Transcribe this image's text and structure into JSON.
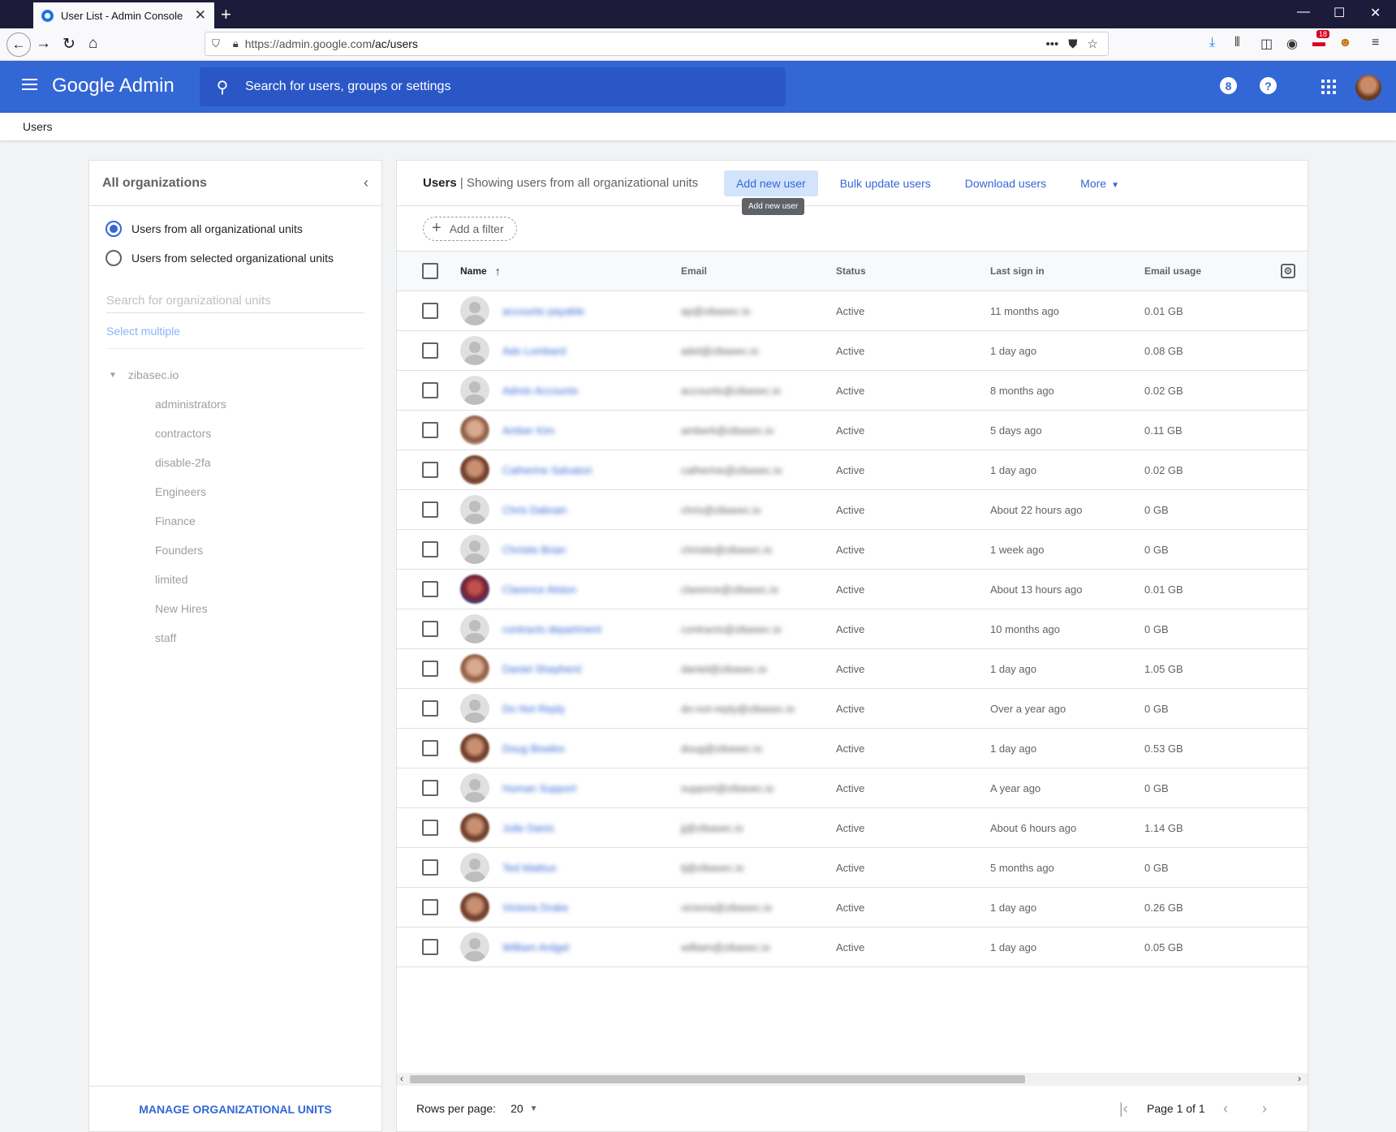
{
  "browser": {
    "tab_title": "User List - Admin Console",
    "url_host": "https://admin.google.com",
    "url_path": "/ac/users",
    "badge_count": "18"
  },
  "header": {
    "brand": "Google Admin",
    "search_placeholder": "Search for users, groups or settings",
    "badge_icon": "8",
    "help_icon": "?"
  },
  "breadcrumb": "Users",
  "left": {
    "title": "All organizations",
    "radio_all": "Users from all organizational units",
    "radio_selected": "Users from selected organizational units",
    "search_placeholder": "Search for organizational units",
    "select_multiple": "Select multiple",
    "root": "zibasec.io",
    "children": [
      "administrators",
      "contractors",
      "disable-2fa",
      "Engineers",
      "Finance",
      "Founders",
      "limited",
      "New Hires",
      "staff"
    ],
    "manage": "MANAGE ORGANIZATIONAL UNITS"
  },
  "main": {
    "title_bold": "Users",
    "title_rest": " | Showing users from all organizational units",
    "actions": {
      "add": "Add new user",
      "bulk": "Bulk update users",
      "download": "Download users",
      "more": "More"
    },
    "tooltip": "Add new user",
    "add_filter": "Add a filter",
    "columns": {
      "name": "Name",
      "email": "Email",
      "status": "Status",
      "last_sign_in": "Last sign in",
      "email_usage": "Email usage"
    },
    "rows": [
      {
        "name": "accounts payable",
        "email": "ap@zibasec.io",
        "status": "Active",
        "last": "11 months ago",
        "usage": "0.01 GB",
        "avatar": "generic"
      },
      {
        "name": "Ado Lombard",
        "email": "adol@zibasec.io",
        "status": "Active",
        "last": "1 day ago",
        "usage": "0.08 GB",
        "avatar": "generic"
      },
      {
        "name": "Admin Accounts",
        "email": "accounts@zibasec.io",
        "status": "Active",
        "last": "8 months ago",
        "usage": "0.02 GB",
        "avatar": "generic"
      },
      {
        "name": "Amber Kim",
        "email": "amberk@zibasec.io",
        "status": "Active",
        "last": "5 days ago",
        "usage": "0.11 GB",
        "avatar": "photo2"
      },
      {
        "name": "Catherine Salvatori",
        "email": "catherine@zibasec.io",
        "status": "Active",
        "last": "1 day ago",
        "usage": "0.02 GB",
        "avatar": "photo"
      },
      {
        "name": "Chris Dabrain",
        "email": "chris@zibasec.io",
        "status": "Active",
        "last": "About 22 hours ago",
        "usage": "0 GB",
        "avatar": "generic"
      },
      {
        "name": "Christie Brian",
        "email": "christie@zibasec.io",
        "status": "Active",
        "last": "1 week ago",
        "usage": "0 GB",
        "avatar": "generic"
      },
      {
        "name": "Clarence Alston",
        "email": "clarence@zibasec.io",
        "status": "Active",
        "last": "About 13 hours ago",
        "usage": "0.01 GB",
        "avatar": "photo3"
      },
      {
        "name": "contracts department",
        "email": "contracts@zibasec.io",
        "status": "Active",
        "last": "10 months ago",
        "usage": "0 GB",
        "avatar": "generic"
      },
      {
        "name": "Daniel Shepherd",
        "email": "daniel@zibasec.io",
        "status": "Active",
        "last": "1 day ago",
        "usage": "1.05 GB",
        "avatar": "photo2"
      },
      {
        "name": "Do Not Reply",
        "email": "do-not-reply@zibasec.io",
        "status": "Active",
        "last": "Over a year ago",
        "usage": "0 GB",
        "avatar": "generic"
      },
      {
        "name": "Doug Bowles",
        "email": "doug@zibasec.io",
        "status": "Active",
        "last": "1 day ago",
        "usage": "0.53 GB",
        "avatar": "photo"
      },
      {
        "name": "Human Support",
        "email": "support@zibasec.io",
        "status": "Active",
        "last": "A year ago",
        "usage": "0 GB",
        "avatar": "generic"
      },
      {
        "name": "Julie Danis",
        "email": "jj@zibasec.io",
        "status": "Active",
        "last": "About 6 hours ago",
        "usage": "1.14 GB",
        "avatar": "photo"
      },
      {
        "name": "Ted Mattius",
        "email": "tj@zibasec.io",
        "status": "Active",
        "last": "5 months ago",
        "usage": "0 GB",
        "avatar": "generic"
      },
      {
        "name": "Victoria Drake",
        "email": "victoria@zibasec.io",
        "status": "Active",
        "last": "1 day ago",
        "usage": "0.26 GB",
        "avatar": "photo"
      },
      {
        "name": "William Ardgel",
        "email": "william@zibasec.io",
        "status": "Active",
        "last": "1 day ago",
        "usage": "0.05 GB",
        "avatar": "generic"
      }
    ],
    "pager": {
      "rows_per_page_label": "Rows per page:",
      "rows_per_page": "20",
      "page_info": "Page 1 of 1"
    }
  },
  "colors": {
    "brand_blue": "#3367d6",
    "search_blue": "#2a56c6",
    "hover_blue": "#d2e3fc"
  }
}
